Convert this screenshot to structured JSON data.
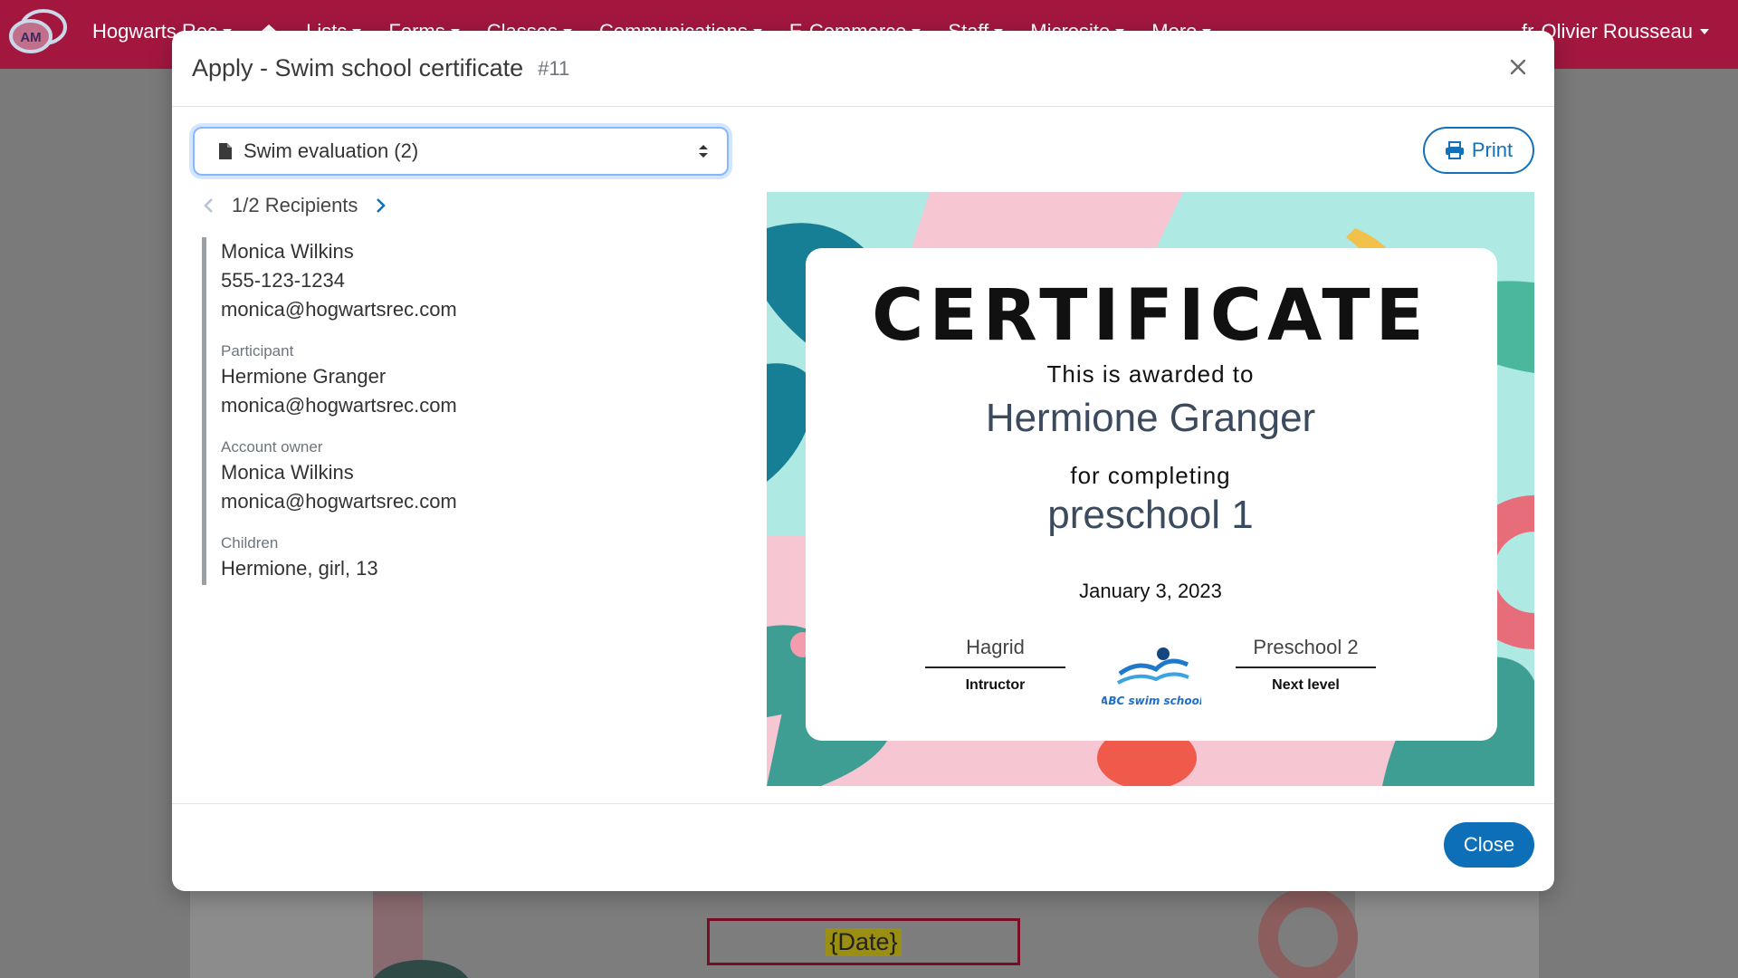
{
  "navbar": {
    "logo_text": "AM",
    "items": [
      "Hogwarts Rec",
      "Lists",
      "Forms",
      "Classes",
      "Communications",
      "E-Commerce",
      "Staff",
      "Microsite",
      "More"
    ],
    "language": "fr",
    "user": "Olivier Rousseau"
  },
  "background": {
    "date_placeholder": "{Date}"
  },
  "modal": {
    "title": "Apply - Swim school certificate",
    "number": "#11",
    "select_value": "Swim evaluation (2)",
    "recipients_label": "1/2 Recipients",
    "print_label": "Print",
    "close_label": "Close",
    "recipient": {
      "name": "Monica Wilkins",
      "phone": "555-123-1234",
      "email": "monica@hogwartsrec.com",
      "participant_label": "Participant",
      "participant_name": "Hermione Granger",
      "participant_email": "monica@hogwartsrec.com",
      "owner_label": "Account owner",
      "owner_name": "Monica Wilkins",
      "owner_email": "monica@hogwartsrec.com",
      "children_label": "Children",
      "children_value": "Hermione, girl, 13"
    }
  },
  "certificate": {
    "title": "CERTIFICATE",
    "awarded_to": "This is awarded to",
    "name": "Hermione Granger",
    "for_completing": "for completing",
    "course": "preschool 1",
    "date": "January 3, 2023",
    "instructor_name": "Hagrid",
    "instructor_role": "Intructor",
    "next_level_name": "Preschool 2",
    "next_level_role": "Next level",
    "logo_text": "ABC swim school"
  },
  "colors": {
    "navbar": "#a3173f",
    "primary": "#1471b8",
    "cert_teal": "#aee9e4",
    "cert_pink": "#f7c6d3"
  }
}
